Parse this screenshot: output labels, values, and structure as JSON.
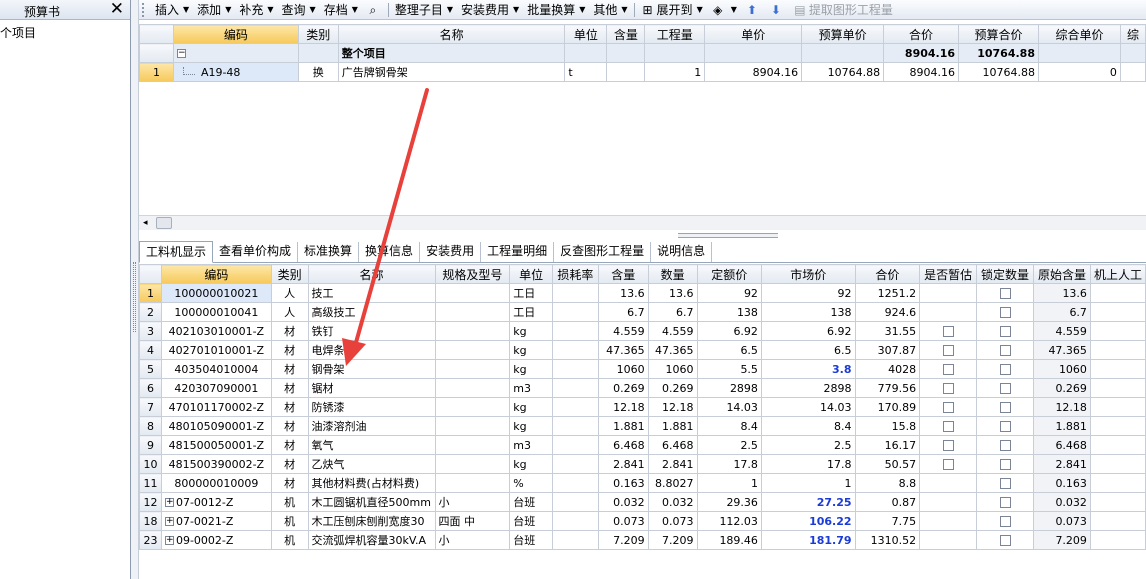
{
  "left_panel": {
    "title": "预算书",
    "close_label": "✕",
    "tree_item": "个项目"
  },
  "toolbar": {
    "items": [
      {
        "label": "插入",
        "dropdown": true
      },
      {
        "label": "添加",
        "dropdown": true
      },
      {
        "label": "补充",
        "dropdown": true
      },
      {
        "label": "查询",
        "dropdown": true
      },
      {
        "label": "存档",
        "dropdown": true
      },
      {
        "label": "",
        "icon": "binoculars-icon"
      },
      {
        "label": "整理子目",
        "dropdown": true
      },
      {
        "label": "安装费用",
        "dropdown": true
      },
      {
        "label": "批量换算",
        "dropdown": true
      },
      {
        "label": "其他",
        "dropdown": true
      },
      {
        "label": "展开到",
        "dropdown": true,
        "icon": "expand-icon"
      },
      {
        "label": "",
        "dropdown": true,
        "icon": "paint-bucket-icon"
      },
      {
        "label": "",
        "icon": "arrow-up-icon"
      },
      {
        "label": "",
        "icon": "arrow-down-icon"
      },
      {
        "label": "提取图形工程量",
        "icon": "extract-icon",
        "disabled": true
      }
    ]
  },
  "top_grid": {
    "headers": [
      "",
      "编码",
      "类别",
      "名称",
      "单位",
      "含量",
      "工程量",
      "单价",
      "预算单价",
      "合价",
      "预算合价",
      "综合单价",
      "综"
    ],
    "group_row": {
      "name": "整个项目",
      "total": "8904.16",
      "budget_total": "10764.88"
    },
    "rows": [
      {
        "no": "1",
        "code": "A19-48",
        "type": "换",
        "name": "广告牌钢骨架",
        "unit": "t",
        "content": "",
        "qty": "1",
        "price": "8904.16",
        "budget_price": "10764.88",
        "total": "8904.16",
        "budget_total": "10764.88",
        "comp_price": "0"
      }
    ]
  },
  "tabs": [
    "工料机显示",
    "查看单价构成",
    "标准换算",
    "换算信息",
    "安装费用",
    "工程量明细",
    "反查图形工程量",
    "说明信息"
  ],
  "bottom_grid": {
    "headers": [
      "",
      "编码",
      "类别",
      "名称",
      "规格及型号",
      "单位",
      "损耗率",
      "含量",
      "数量",
      "定额价",
      "市场价",
      "合价",
      "是否暂估",
      "锁定数量",
      "原始含量",
      "机上人工"
    ],
    "rows": [
      {
        "no": "1",
        "code": "100000010021",
        "type": "人",
        "name": "技工",
        "spec": "",
        "unit": "工日",
        "loss": "",
        "content": "13.6",
        "qty": "13.6",
        "quota": "92",
        "market": "92",
        "market_blue": false,
        "total": "1251.2",
        "est": false,
        "lock": true,
        "orig": "13.6",
        "expand": false
      },
      {
        "no": "2",
        "code": "100000010041",
        "type": "人",
        "name": "高级技工",
        "spec": "",
        "unit": "工日",
        "loss": "",
        "content": "6.7",
        "qty": "6.7",
        "quota": "138",
        "market": "138",
        "market_blue": false,
        "total": "924.6",
        "est": false,
        "lock": true,
        "orig": "6.7",
        "expand": false
      },
      {
        "no": "3",
        "code": "402103010001-Z",
        "type": "材",
        "name": "铁钉",
        "spec": "",
        "unit": "kg",
        "loss": "",
        "content": "4.559",
        "qty": "4.559",
        "quota": "6.92",
        "market": "6.92",
        "market_blue": false,
        "total": "31.55",
        "est": true,
        "lock": true,
        "orig": "4.559",
        "expand": false
      },
      {
        "no": "4",
        "code": "402701010001-Z",
        "type": "材",
        "name": "电焊条",
        "spec": "",
        "unit": "kg",
        "loss": "",
        "content": "47.365",
        "qty": "47.365",
        "quota": "6.5",
        "market": "6.5",
        "market_blue": false,
        "total": "307.87",
        "est": true,
        "lock": true,
        "orig": "47.365",
        "expand": false
      },
      {
        "no": "5",
        "code": "403504010004",
        "type": "材",
        "name": "钢骨架",
        "spec": "",
        "unit": "kg",
        "loss": "",
        "content": "1060",
        "qty": "1060",
        "quota": "5.5",
        "market": "3.8",
        "market_blue": true,
        "total": "4028",
        "est": true,
        "lock": true,
        "orig": "1060",
        "expand": false
      },
      {
        "no": "6",
        "code": "420307090001",
        "type": "材",
        "name": "锯材",
        "spec": "",
        "unit": "m3",
        "loss": "",
        "content": "0.269",
        "qty": "0.269",
        "quota": "2898",
        "market": "2898",
        "market_blue": false,
        "total": "779.56",
        "est": true,
        "lock": true,
        "orig": "0.269",
        "expand": false
      },
      {
        "no": "7",
        "code": "470101170002-Z",
        "type": "材",
        "name": "防锈漆",
        "spec": "",
        "unit": "kg",
        "loss": "",
        "content": "12.18",
        "qty": "12.18",
        "quota": "14.03",
        "market": "14.03",
        "market_blue": false,
        "total": "170.89",
        "est": true,
        "lock": true,
        "orig": "12.18",
        "expand": false
      },
      {
        "no": "8",
        "code": "480105090001-Z",
        "type": "材",
        "name": "油漆溶剂油",
        "spec": "",
        "unit": "kg",
        "loss": "",
        "content": "1.881",
        "qty": "1.881",
        "quota": "8.4",
        "market": "8.4",
        "market_blue": false,
        "total": "15.8",
        "est": true,
        "lock": true,
        "orig": "1.881",
        "expand": false
      },
      {
        "no": "9",
        "code": "481500050001-Z",
        "type": "材",
        "name": "氧气",
        "spec": "",
        "unit": "m3",
        "loss": "",
        "content": "6.468",
        "qty": "6.468",
        "quota": "2.5",
        "market": "2.5",
        "market_blue": false,
        "total": "16.17",
        "est": true,
        "lock": true,
        "orig": "6.468",
        "expand": false
      },
      {
        "no": "10",
        "code": "481500390002-Z",
        "type": "材",
        "name": "乙炔气",
        "spec": "",
        "unit": "kg",
        "loss": "",
        "content": "2.841",
        "qty": "2.841",
        "quota": "17.8",
        "market": "17.8",
        "market_blue": false,
        "total": "50.57",
        "est": true,
        "lock": true,
        "orig": "2.841",
        "expand": false
      },
      {
        "no": "11",
        "code": "800000010009",
        "type": "材",
        "name": "其他材料费(占材料费)",
        "spec": "",
        "unit": "%",
        "loss": "",
        "content": "0.163",
        "qty": "8.8027",
        "quota": "1",
        "market": "1",
        "market_blue": false,
        "total": "8.8",
        "est": false,
        "lock": true,
        "orig": "0.163",
        "expand": false
      },
      {
        "no": "12",
        "code": "07-0012-Z",
        "type": "机",
        "name": "木工圆锯机直径500mm",
        "spec": "小",
        "unit": "台班",
        "loss": "",
        "content": "0.032",
        "qty": "0.032",
        "quota": "29.36",
        "market": "27.25",
        "market_blue": true,
        "total": "0.87",
        "est": false,
        "lock": true,
        "orig": "0.032",
        "expand": true
      },
      {
        "no": "18",
        "code": "07-0021-Z",
        "type": "机",
        "name": "木工压刨床刨削宽度30",
        "spec": "四面 中",
        "unit": "台班",
        "loss": "",
        "content": "0.073",
        "qty": "0.073",
        "quota": "112.03",
        "market": "106.22",
        "market_blue": true,
        "total": "7.75",
        "est": false,
        "lock": true,
        "orig": "0.073",
        "expand": true
      },
      {
        "no": "23",
        "code": "09-0002-Z",
        "type": "机",
        "name": "交流弧焊机容量30kV.A",
        "spec": "小",
        "unit": "台班",
        "loss": "",
        "content": "7.209",
        "qty": "7.209",
        "quota": "189.46",
        "market": "181.79",
        "market_blue": true,
        "total": "1310.52",
        "est": false,
        "lock": true,
        "orig": "7.209",
        "expand": true
      }
    ]
  },
  "colors": {
    "accent_blue": "#1a3bd6",
    "selected_header": "#f6c95b",
    "annotation_arrow": "#e8403a"
  }
}
